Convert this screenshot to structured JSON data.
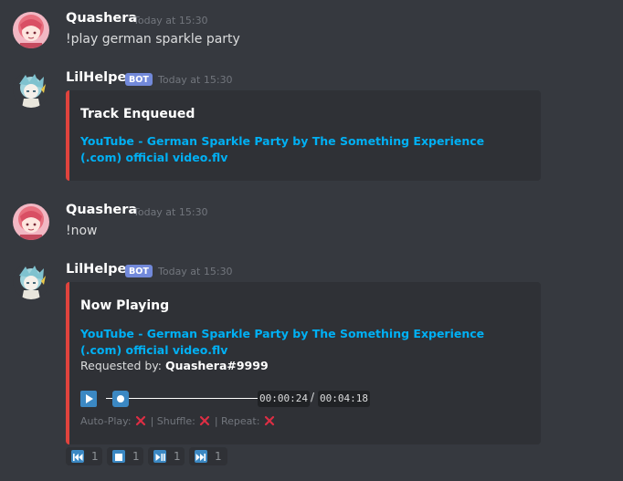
{
  "messages": [
    {
      "author": "Quashera",
      "timestamp": "Today at 15:30",
      "content": "!play german sparkle party"
    },
    {
      "author": "LilHelper",
      "bot_tag": "BOT",
      "timestamp": "Today at 15:30",
      "embed": {
        "title": "Track Enqueued",
        "link": "YouTube - German Sparkle Party by The Something Experience (.com) official video.flv"
      }
    },
    {
      "author": "Quashera",
      "timestamp": "Today at 15:30",
      "content": "!now"
    },
    {
      "author": "LilHelper",
      "bot_tag": "BOT",
      "timestamp": "Today at 15:30",
      "embed": {
        "title": "Now Playing",
        "link": "YouTube - German Sparkle Party by The Something Experience (.com) official video.flv",
        "requested_label": "Requested by:",
        "requested_user": "Quashera#9999",
        "time_elapsed": "00:00:24",
        "time_separator": "/",
        "time_total": "00:04:18",
        "progress_fraction": 0.093,
        "autoplay_label": "Auto-Play:",
        "shuffle_label": "| Shuffle:",
        "repeat_label": "| Repeat:"
      }
    }
  ],
  "reactions": [
    {
      "icon": "previous-track-icon",
      "count": "1"
    },
    {
      "icon": "stop-icon",
      "count": "1"
    },
    {
      "icon": "play-pause-icon",
      "count": "1"
    },
    {
      "icon": "next-track-icon",
      "count": "1"
    }
  ],
  "colors": {
    "background": "#36393f",
    "embed_background": "#2f3136",
    "embed_accent": "#e0433d",
    "link": "#00b0f4",
    "bot_tag": "#7289da",
    "icon_blue": "#3b88c3"
  }
}
